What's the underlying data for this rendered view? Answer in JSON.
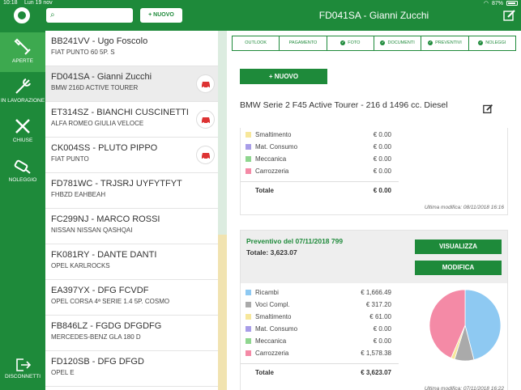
{
  "status_bar": {
    "time": "10:18",
    "date": "Lun 19 nov",
    "battery": "87%"
  },
  "rail": {
    "items": [
      {
        "label": "APERTE",
        "icon": "wrench-icon",
        "active": true
      },
      {
        "label": "IN LAVORAZIONE",
        "icon": "wrench-icon",
        "active": false
      },
      {
        "label": "CHIUSE",
        "icon": "tools-icon",
        "active": false
      },
      {
        "label": "NOLEGGIO",
        "icon": "car-key-icon",
        "active": false
      }
    ],
    "logout_label": "DISCONNETTI"
  },
  "search": {
    "value": "",
    "placeholder": ""
  },
  "new_button_top": "+ NUOVO",
  "list": [
    {
      "title": "BB241VV - Ugo Foscolo",
      "subtitle": "FIAT PUNTO 60 5P. S",
      "car": false
    },
    {
      "title": "FD041SA - Gianni Zucchi",
      "subtitle": "BMW 216D ACTIVE TOURER",
      "car": true,
      "selected": true
    },
    {
      "title": "ET314SZ - BIANCHI CUSCINETTI",
      "subtitle": "ALFA ROMEO GIULIA VELOCE",
      "car": true
    },
    {
      "title": "CK004SS - PLUTO PIPPO",
      "subtitle": "FIAT PUNTO",
      "car": true
    },
    {
      "title": "FD781WC - TRJSRJ UYFYTFYT",
      "subtitle": "FHBZD EAHBEAH",
      "car": false
    },
    {
      "title": "FC299NJ - MARCO ROSSI",
      "subtitle": "NISSAN NISSAN QASHQAI",
      "car": false
    },
    {
      "title": "FK081RY - DANTE DANTI",
      "subtitle": "OPEL KARLROCKS",
      "car": false
    },
    {
      "title": "EA397YX - DFG FCVDF",
      "subtitle": "OPEL CORSA 4ª SERIE 1.4 5P. COSMO",
      "car": false
    },
    {
      "title": "FB846LZ - FGDG DFGDFG",
      "subtitle": "MERCEDES-BENZ GLA 180 D",
      "car": false
    },
    {
      "title": "FD120SB - DFG DFGD",
      "subtitle": "OPEL E",
      "car": false
    }
  ],
  "detail": {
    "title": "FD041SA - Gianni Zucchi",
    "steps": [
      {
        "label": "OUTLOOK",
        "done": false
      },
      {
        "label": "PAGAMENTO",
        "done": false
      },
      {
        "label": "FOTO",
        "done": true
      },
      {
        "label": "DOCUMENTI",
        "done": true
      },
      {
        "label": "PREVENTIVI",
        "done": true
      },
      {
        "label": "NOLEGGI",
        "done": true
      }
    ],
    "new_button": "+ NUOVO",
    "vehicle": "BMW Serie 2 F45 Active Tourer - 216 d 1496 cc. Diesel",
    "card1": {
      "rows": [
        {
          "label": "Smaltimento",
          "amount": "€ 0.00",
          "color": "#f7e79b"
        },
        {
          "label": "Mat. Consumo",
          "amount": "€ 0.00",
          "color": "#a89de8"
        },
        {
          "label": "Meccanica",
          "amount": "€ 0.00",
          "color": "#8fd68f"
        },
        {
          "label": "Carrozzeria",
          "amount": "€ 0.00",
          "color": "#f48aa6"
        }
      ],
      "total_label": "Totale",
      "total_amount": "€ 0.00",
      "modified": "Ultima modifica: 08/11/2018 16:16"
    },
    "card2": {
      "title": "Preventivo del 07/11/2018 799",
      "total": "Totale: 3,623.07",
      "view_button": "VISUALIZZA",
      "edit_button": "MODIFICA",
      "rows": [
        {
          "label": "Ricambi",
          "amount": "€ 1,666.49",
          "color": "#8ec9f2"
        },
        {
          "label": "Voci Compl.",
          "amount": "€ 317.20",
          "color": "#aaaaaa"
        },
        {
          "label": "Smaltimento",
          "amount": "€ 61.00",
          "color": "#f7e79b"
        },
        {
          "label": "Mat. Consumo",
          "amount": "€ 0.00",
          "color": "#a89de8"
        },
        {
          "label": "Meccanica",
          "amount": "€ 0.00",
          "color": "#8fd68f"
        },
        {
          "label": "Carrozzeria",
          "amount": "€ 1,578.38",
          "color": "#f48aa6"
        }
      ],
      "total_label": "Totale",
      "total_amount": "€ 3,623.07",
      "modified": "Ultima modifica: 07/11/2018 16:22"
    },
    "pie": [
      {
        "label": "Ricambi",
        "value": 1666.49,
        "color": "#8ec9f2"
      },
      {
        "label": "Voci Compl.",
        "value": 317.2,
        "color": "#aaaaaa"
      },
      {
        "label": "Smaltimento",
        "value": 61.0,
        "color": "#f7e79b"
      },
      {
        "label": "Carrozzeria",
        "value": 1578.38,
        "color": "#f48aa6"
      }
    ]
  }
}
